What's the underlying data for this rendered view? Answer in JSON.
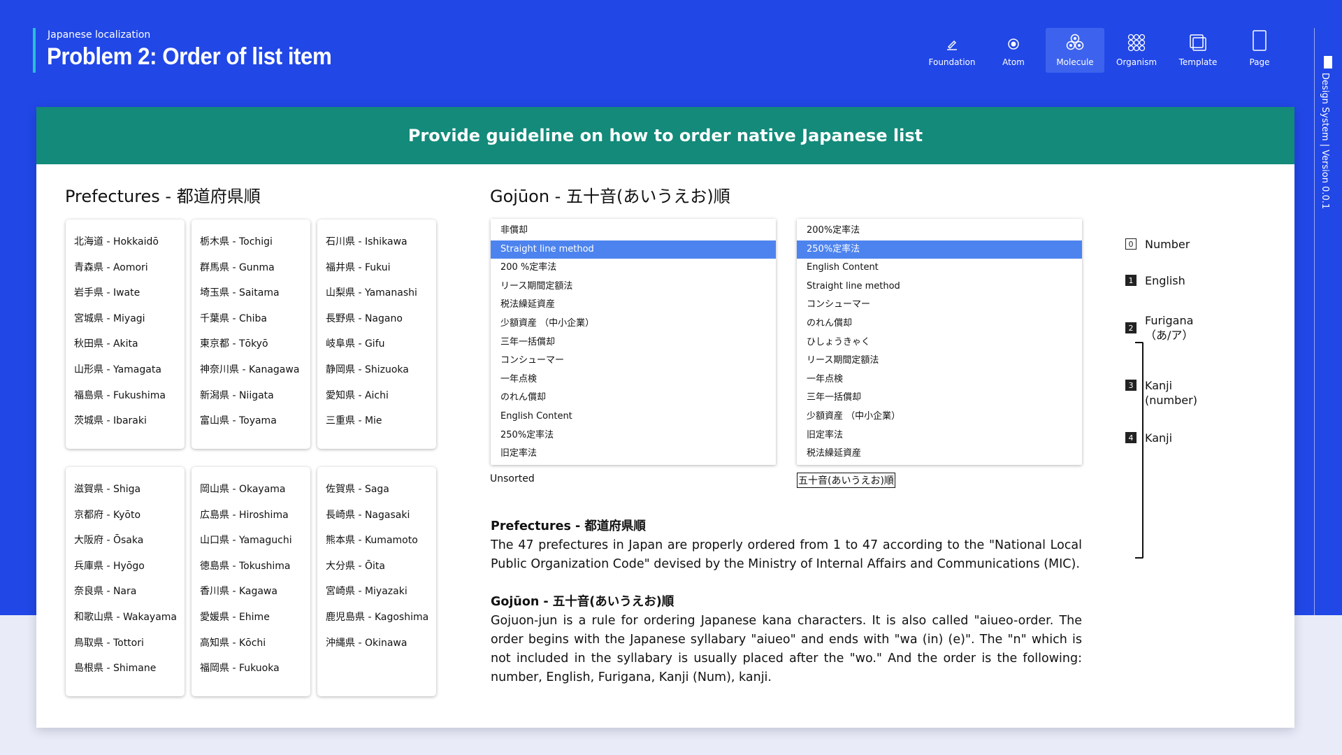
{
  "header": {
    "kicker": "Japanese localization",
    "title": "Problem 2: Order of list item"
  },
  "nav": [
    {
      "label": "Foundation",
      "icon": "pencil-icon"
    },
    {
      "label": "Atom",
      "icon": "atom-dot-icon"
    },
    {
      "label": "Molecule",
      "icon": "molecule-icon",
      "active": true
    },
    {
      "label": "Organism",
      "icon": "organism-grid-icon"
    },
    {
      "label": "Template",
      "icon": "template-icon"
    },
    {
      "label": "Page",
      "icon": "page-icon"
    }
  ],
  "side": {
    "text": "Design System  |  Version 0.0.1"
  },
  "banner": "Provide guideline on how to order native Japanese list",
  "prefectures": {
    "title": "Prefectures - 都道府県順",
    "columns": [
      [
        "北海道 - Hokkaidō",
        "青森県 - Aomori",
        "岩手県 - Iwate",
        "宮城県 - Miyagi",
        "秋田県 - Akita",
        "山形県 - Yamagata",
        "福島県 - Fukushima",
        "茨城県 - Ibaraki"
      ],
      [
        "栃木県 - Tochigi",
        "群馬県 - Gunma",
        "埼玉県 - Saitama",
        "千葉県 - Chiba",
        "東京都 - Tōkyō",
        "神奈川県 - Kanagawa",
        "新潟県 - Niigata",
        "富山県 - Toyama"
      ],
      [
        "石川県 - Ishikawa",
        "福井県 - Fukui",
        "山梨県 - Yamanashi",
        "長野県 - Nagano",
        "岐阜県 - Gifu",
        "静岡県 - Shizuoka",
        "愛知県 - Aichi",
        "三重県 - Mie"
      ],
      [
        "滋賀県 - Shiga",
        "京都府 - Kyōto",
        "大阪府 - Ōsaka",
        "兵庫県 - Hyōgo",
        "奈良県 - Nara",
        "和歌山県 - Wakayama",
        "鳥取県 - Tottori",
        "島根県 - Shimane"
      ],
      [
        "岡山県 - Okayama",
        "広島県 - Hiroshima",
        "山口県 - Yamaguchi",
        "徳島県 - Tokushima",
        "香川県 - Kagawa",
        "愛媛県 - Ehime",
        "高知県 - Kōchi",
        "福岡県 - Fukuoka"
      ],
      [
        "佐賀県 - Saga",
        "長崎県 - Nagasaki",
        "熊本県 - Kumamoto",
        "大分県 - Ōita",
        "宮崎県 - Miyazaki",
        "鹿児島県 - Kagoshima",
        "沖縄県 - Okinawa"
      ]
    ]
  },
  "gojuon": {
    "title": "Gojūon - 五十音(あいうえお)順",
    "unsorted": {
      "caption": "Unsorted",
      "selected_index": 1,
      "items": [
        "非償却",
        "Straight line method",
        "200 %定率法",
        "リース期間定額法",
        "税法繰延資産",
        "少額資産 （中小企業）",
        "三年一括償却",
        "コンシューマー",
        "一年点検",
        "のれん償却",
        "English Content",
        "250%定率法",
        "旧定率法"
      ]
    },
    "sorted": {
      "caption": "五十音(あいうえお)順",
      "selected_index": 1,
      "items": [
        "200%定率法",
        "250%定率法",
        "English Content",
        "Straight line method",
        "コンシューマー",
        "のれん償却",
        "ひしょうきゃく",
        "リース期間定額法",
        "一年点検",
        "三年一括償却",
        "少額資産 （中小企業）",
        "旧定率法",
        "税法繰延資産"
      ]
    },
    "order": [
      {
        "num": "0",
        "label": "Number"
      },
      {
        "num": "1",
        "label": "English"
      },
      {
        "num": "2",
        "label": "Furigana",
        "sub": "（あ/ア）"
      },
      {
        "num": "3",
        "label": "Kanji",
        "sub": "(number)"
      },
      {
        "num": "4",
        "label": "Kanji"
      }
    ]
  },
  "descriptions": {
    "pref_heading": "Prefectures - 都道府県順",
    "pref_text": "The 47 prefectures in Japan are properly ordered from 1 to 47 according to the \"National Local Public Organization Code\" devised by the Ministry of Internal Affairs and Communications (MIC).",
    "gojuon_heading": "Gojūon - 五十音(あいうえお)順",
    "gojuon_text": "Gojuon-jun is a rule for ordering Japanese kana characters. It is also called \"aiueo-order. The order begins with the Japanese syllabary \"aiueo\" and ends with \"wa (in) (e)\". The \"n\" which is not included in the syllabary is usually placed after the \"wo.\" And the order is the following: number, English, Furigana, Kanji (Num), kanji."
  }
}
